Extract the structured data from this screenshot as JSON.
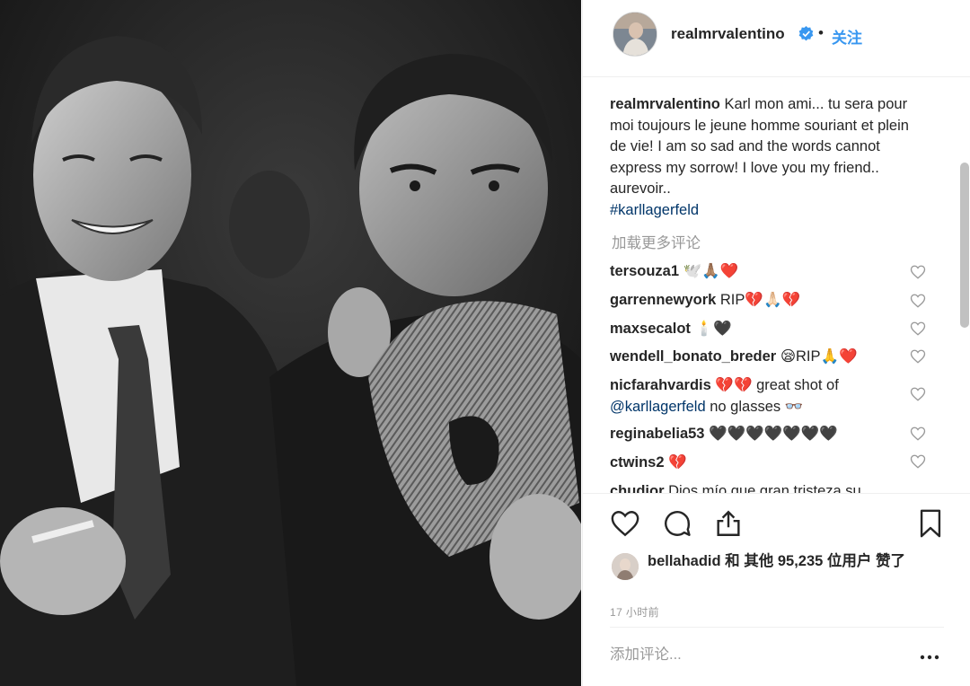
{
  "header": {
    "username": "realmrvalentino",
    "separator": "•",
    "follow_label": "关注",
    "verified_icon": "verified-badge-icon"
  },
  "caption": {
    "username": "realmrvalentino",
    "text": "Karl mon ami... tu sera pour moi toujours le jeune homme souriant et plein de vie! I am so sad and the words cannot express my sorrow! I love you my friend.. aurevoir..",
    "hashtag": "#karllagerfeld"
  },
  "load_more": "加载更多评论",
  "comments": [
    {
      "username": "tersouza1",
      "text": "🕊️🙏🏽❤️"
    },
    {
      "username": "garrennewyork",
      "text": "RIP💔🙏🏻💔"
    },
    {
      "username": "maxsecalot",
      "text": "🕯️🖤"
    },
    {
      "username": "wendell_bonato_breder",
      "text": "😪RIP🙏❤️"
    },
    {
      "username": "nicfarahvardis",
      "text": "💔💔 great shot of",
      "mention": "@karllagerfeld",
      "text_after": "no glasses 👓"
    },
    {
      "username": "reginabelia53",
      "text": "🖤🖤🖤🖤🖤🖤🖤"
    },
    {
      "username": "ctwins2",
      "text": "💔"
    },
    {
      "username": "chudior",
      "text": "Dios mío que gran tristeza su"
    }
  ],
  "actions": {
    "like_icon": "heart-outline-icon",
    "comment_icon": "comment-bubble-icon",
    "share_icon": "share-upload-icon",
    "save_icon": "bookmark-icon"
  },
  "likes": {
    "liker": "bellahadid",
    "text": "bellahadid 和 其他 95,235 位用户 赞了"
  },
  "timestamp": "17 小时前",
  "add_comment": {
    "placeholder": "添加评论..."
  },
  "more_icon": "more-dots-icon",
  "colors": {
    "link_blue": "#3897f0",
    "hashtag": "#003569",
    "muted": "#999999",
    "text": "#262626"
  }
}
